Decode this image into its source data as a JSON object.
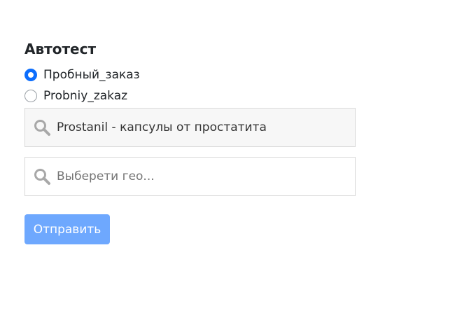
{
  "form": {
    "title": "Автотест",
    "radio_options": [
      {
        "label": "Пробный_заказ",
        "checked": true
      },
      {
        "label": "Probniy_zakaz",
        "checked": false
      }
    ],
    "product_select": {
      "value": "Prostanil - капсулы от простатита"
    },
    "geo_select": {
      "placeholder": "Выберети гео..."
    },
    "submit_label": "Отправить"
  },
  "colors": {
    "radio_checked": "#0d6efd",
    "submit_bg": "#6ea8fe",
    "icon": "#a8a8a8"
  },
  "icons": {
    "search": "search-icon"
  }
}
